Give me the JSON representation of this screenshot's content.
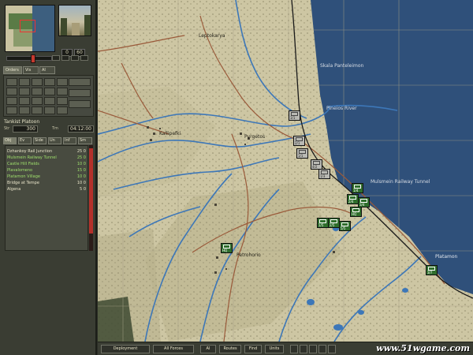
{
  "left_panel": {
    "speed_values": [
      "0",
      "60"
    ],
    "order_tabs": [
      "Orders",
      "Vis",
      "AI"
    ],
    "unit_name": "Tankist Platoon",
    "strength_label": "Str",
    "strength_value": "300",
    "time_label": "Tm",
    "time_value": "04:12:00",
    "list_tabs": [
      "Obj",
      "Ev",
      "Side",
      "Un",
      "Inf",
      "Sm"
    ],
    "objectives": [
      {
        "name": "Dzhankoy Rail Junction",
        "value": "25 0",
        "color": "#e9e4c9"
      },
      {
        "name": "Mulsmein Railway Tunnel",
        "value": "25 0",
        "color": "#9fe06c"
      },
      {
        "name": "Castle Hill Fields",
        "value": "10 0",
        "color": "#9fe06c"
      },
      {
        "name": "Plavalomeno",
        "value": "15 0",
        "color": "#9fe06c"
      },
      {
        "name": "Platamon Village",
        "value": "10 0",
        "color": "#9fe06c"
      },
      {
        "name": "Bridge at Tempe",
        "value": "10 0",
        "color": "#e9e4c9"
      },
      {
        "name": "Algena",
        "value": "5 0",
        "color": "#e9e4c9"
      }
    ]
  },
  "map_labels": {
    "north_town": "Leptokarya",
    "east_coast": "Skala Panteleimon",
    "river_mouth": "Pineios River",
    "west_village": "Kallipefki",
    "middle_village": "Pyrgetos",
    "tunnel": "Mulsmein Railway Tunnel",
    "south_village": "Petrohorio",
    "platamon": "Platamon"
  },
  "counters": [
    {
      "color": "gray",
      "num": "3/1"
    },
    {
      "color": "gray",
      "num": "2/1"
    },
    {
      "color": "gray",
      "num": "1/1"
    },
    {
      "color": "gray",
      "num": "4/2"
    },
    {
      "color": "gray",
      "num": "1/3"
    },
    {
      "color": "green",
      "num": "1/4"
    },
    {
      "color": "green",
      "num": "2/4"
    },
    {
      "color": "green",
      "num": "3/4"
    },
    {
      "color": "green",
      "num": "HQ"
    },
    {
      "color": "green",
      "num": "1/5"
    },
    {
      "color": "green",
      "num": "2/5"
    },
    {
      "color": "green",
      "num": "5/5"
    },
    {
      "color": "green",
      "num": "HQ"
    },
    {
      "color": "green",
      "num": "3/7"
    }
  ],
  "bottom_bar": {
    "buttons": [
      "Deployment",
      "All Forces",
      "AI",
      "Routes",
      "Find",
      "Units"
    ],
    "watermark": "www.51wgame.com"
  },
  "colors": {
    "land": "#c9c29f",
    "sea": "#2f507a",
    "river": "#3d77b8",
    "road": "#9a5a3a",
    "railway": "#1a1a1a",
    "friendly_unit": "#2f6e2c",
    "enemy_unit": "#b9b9b3",
    "red_slider": "#b3302a"
  }
}
